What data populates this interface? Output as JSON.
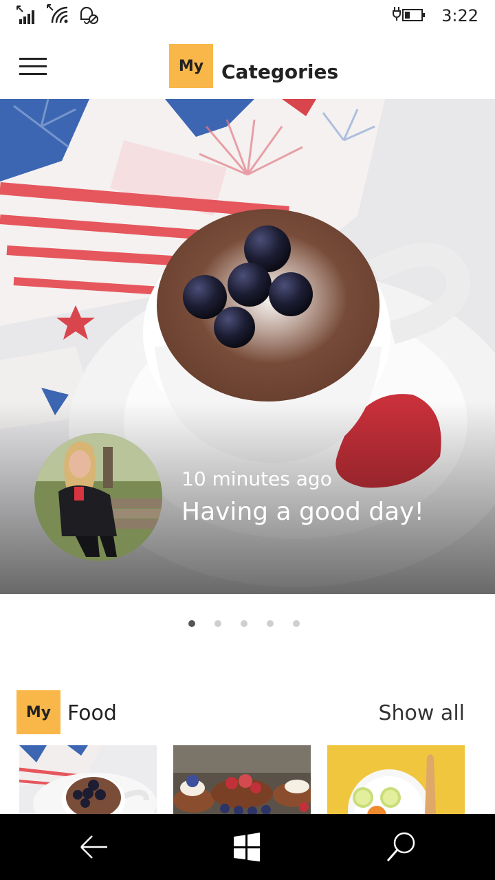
{
  "status_bar": {
    "time": "3:22",
    "icons": [
      "signal-icon",
      "wifi-icon",
      "alarm-off-icon",
      "battery-charging-icon"
    ]
  },
  "header": {
    "logo_text": "My",
    "title": "Categories",
    "menu_icon": "hamburger-icon"
  },
  "hero": {
    "image": "mug-cake-with-blueberries",
    "avatar": "woman-on-bench-photo",
    "timestamp": "10 minutes ago",
    "caption": "Having a good day!"
  },
  "carousel": {
    "count": 5,
    "active_index": 0
  },
  "section": {
    "logo_text": "My",
    "title": "Food",
    "show_all_label": "Show all",
    "thumbnails": [
      "mug-cake-thumbnail",
      "pancakes-thumbnail",
      "citrus-plate-thumbnail"
    ]
  },
  "nav_bar": {
    "back_icon": "back-arrow-icon",
    "home_icon": "windows-logo-icon",
    "search_icon": "search-icon"
  },
  "colors": {
    "accent": "#f9b74a",
    "nav_background": "#000000"
  }
}
